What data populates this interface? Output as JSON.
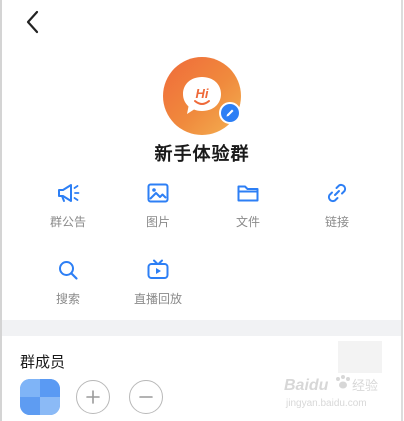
{
  "header": {
    "back_icon": "chevron-left-icon"
  },
  "group": {
    "avatar_text": "Hi",
    "avatar_colors": [
      "#ef6a3a",
      "#f3b152"
    ],
    "edit_icon": "pencil-icon",
    "name": "新手体验群"
  },
  "functions": [
    {
      "label": "群公告",
      "icon": "megaphone-icon"
    },
    {
      "label": "图片",
      "icon": "image-icon"
    },
    {
      "label": "文件",
      "icon": "folder-icon"
    },
    {
      "label": "链接",
      "icon": "link-icon"
    },
    {
      "label": "搜索",
      "icon": "search-icon"
    },
    {
      "label": "直播回放",
      "icon": "tv-replay-icon"
    }
  ],
  "members": {
    "title": "群成员",
    "add_icon": "plus-icon",
    "remove_icon": "minus-icon"
  },
  "colors": {
    "accent": "#2d7ff5",
    "label_gray": "#8a8a8a",
    "section_gap": "#f1f2f4"
  },
  "watermark": {
    "brand": "Baidu",
    "brand_cn": "经验",
    "url": "jingyan.baidu.com"
  }
}
